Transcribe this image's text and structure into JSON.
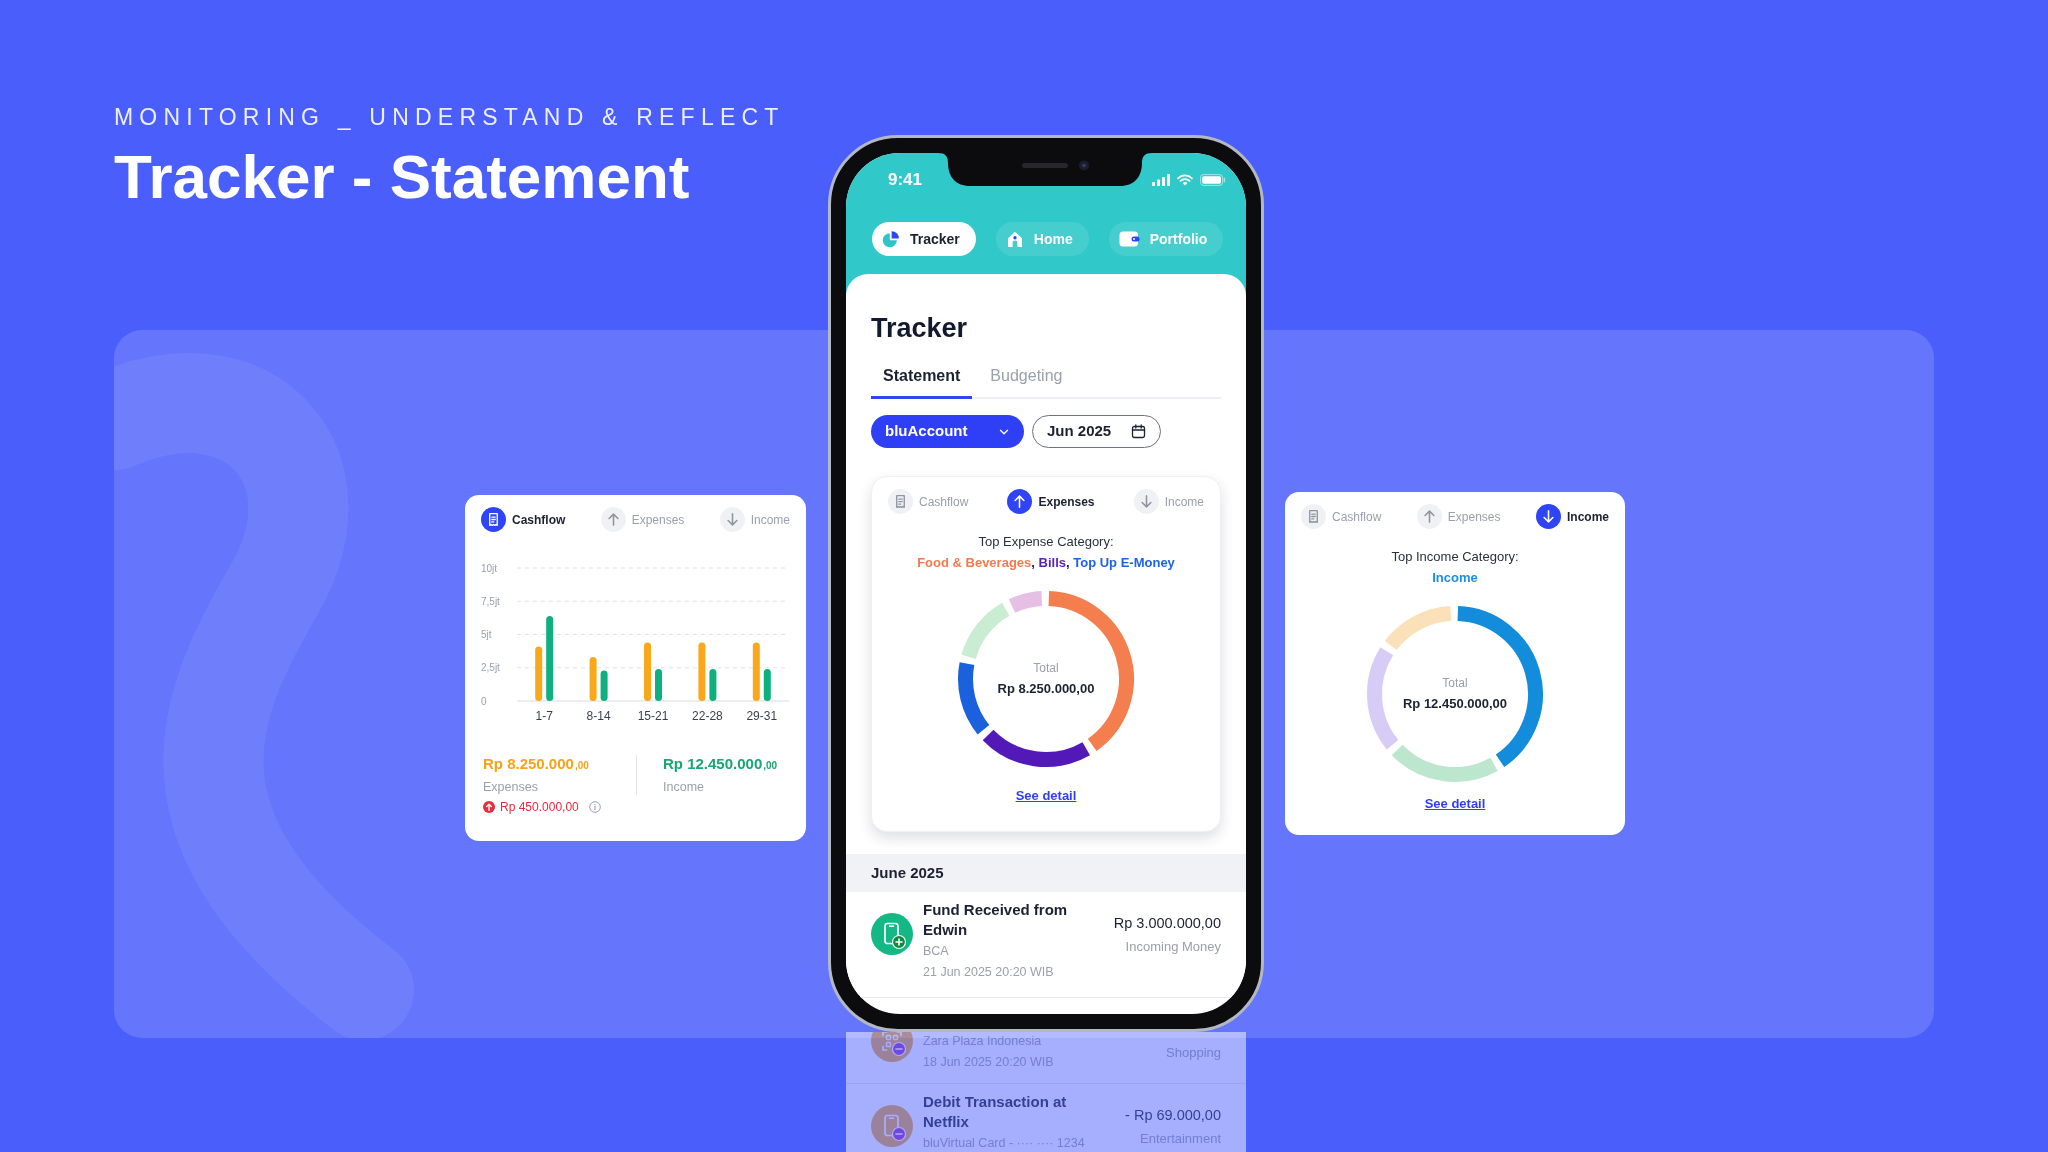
{
  "header": {
    "eyebrow": "MONITORING _ UNDERSTAND & REFLECT",
    "title": "Tracker - Statement"
  },
  "cashflow_card": {
    "tabs": [
      {
        "label": "Cashflow",
        "selected": true
      },
      {
        "label": "Expenses",
        "selected": false
      },
      {
        "label": "Income",
        "selected": false
      }
    ],
    "chart_data": {
      "type": "bar",
      "categories": [
        "1-7",
        "8-14",
        "15-21",
        "22-28",
        "29-31"
      ],
      "series": [
        {
          "color": "#f9a81b",
          "values": [
            4.1,
            3.3,
            4.4,
            4.4,
            4.4
          ]
        },
        {
          "color": "#0db07e",
          "values": [
            6.4,
            2.3,
            2.4,
            2.4,
            2.4
          ]
        }
      ],
      "ylim": [
        0,
        10
      ],
      "yticks": [
        0,
        {
          "value": 2.5,
          "label": "2,5jt"
        },
        {
          "value": 5,
          "label": "5jt"
        },
        {
          "value": 7.5,
          "label": "7,5jt"
        },
        {
          "value": 10,
          "label": "10jt"
        }
      ],
      "grid": true
    },
    "summary": [
      {
        "amount": "Rp 8.250.000",
        "decimals": ",00",
        "label": "Expenses",
        "color": "#f7a21b"
      },
      {
        "amount": "Rp 12.450.000",
        "decimals": ",00",
        "label": "Income",
        "color": "#18a673"
      }
    ],
    "difference": "Rp 450.000,00"
  },
  "phone": {
    "status_bar": {
      "time": "9:41"
    },
    "nav": [
      {
        "label": "Tracker",
        "selected": true
      },
      {
        "label": "Home",
        "selected": false
      },
      {
        "label": "Portfolio",
        "selected": false
      }
    ],
    "title": "Tracker",
    "tabs": [
      {
        "label": "Statement",
        "selected": true
      },
      {
        "label": "Budgeting",
        "selected": false
      }
    ],
    "account_dropdown": {
      "value": "bluAccount"
    },
    "month_picker": {
      "value": "Jun 2025"
    },
    "category_card": {
      "tabs": [
        {
          "label": "Cashflow",
          "selected": false
        },
        {
          "label": "Expenses",
          "selected": true
        },
        {
          "label": "Income",
          "selected": false
        }
      ],
      "heading": "Top Expense Category:",
      "categories": [
        {
          "label": "Food & Beverages",
          "color": "#f47b4d",
          "separator": ","
        },
        {
          "label": "Bills",
          "color": "#5a1fb5",
          "separator": ","
        },
        {
          "label": "Top Up E-Money",
          "color": "#1f63e0"
        }
      ],
      "total_label": "Total",
      "total": "Rp 8.250.000,00",
      "link": "See detail"
    },
    "section_title": "June 2025",
    "transactions": [
      {
        "kind": "incoming",
        "title": "Fund Received from Edwin",
        "source": "BCA",
        "date": "21 Jun 2025 20:20 WIB",
        "amount": "Rp 3.000.000,00",
        "category": "Incoming Money"
      },
      {
        "kind": "qr_payment",
        "source": "Zara Plaza Indonesia",
        "date": "18 Jun 2025 20:20 WIB",
        "category": "Shopping"
      },
      {
        "kind": "debit",
        "title": "Debit Transaction at Netflix",
        "source": "bluVirtual Card - ···· ···· 1234",
        "amount": "- Rp 69.000,00",
        "category": "Entertainment"
      }
    ]
  },
  "income_card": {
    "tabs": [
      {
        "label": "Cashflow",
        "selected": false
      },
      {
        "label": "Expenses",
        "selected": false
      },
      {
        "label": "Income",
        "selected": true
      }
    ],
    "heading": "Top Income Category:",
    "categories": [
      {
        "label": "Income",
        "color": "#1d8fe0"
      }
    ],
    "total_label": "Total",
    "total": "Rp 12.450.000,00",
    "link": "See detail"
  }
}
